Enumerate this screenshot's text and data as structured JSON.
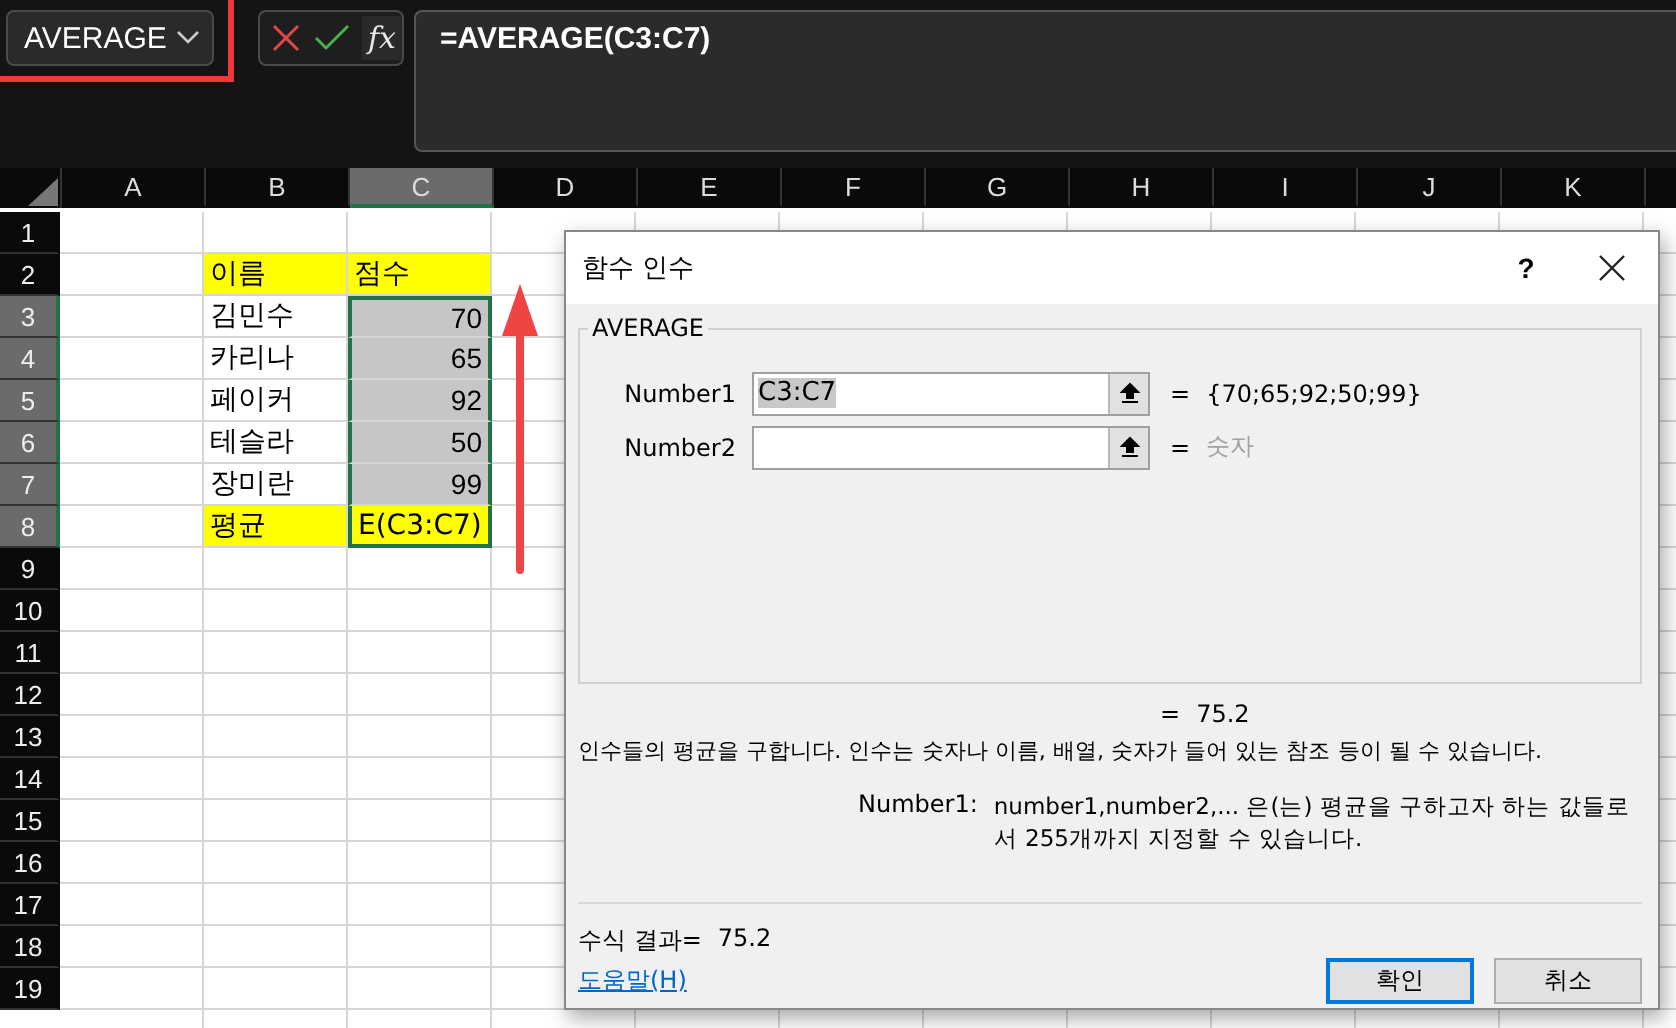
{
  "name_box": {
    "value": "AVERAGE",
    "highlighted": true
  },
  "formula_tools": {
    "function_label": "fx"
  },
  "formula_bar": {
    "value": "=AVERAGE(C3:C7)"
  },
  "sheet": {
    "columns": [
      {
        "label": "A",
        "selected": false
      },
      {
        "label": "B",
        "selected": false
      },
      {
        "label": "C",
        "selected": true
      },
      {
        "label": "D",
        "selected": false
      },
      {
        "label": "E",
        "selected": false
      },
      {
        "label": "F",
        "selected": false
      },
      {
        "label": "G",
        "selected": false
      },
      {
        "label": "H",
        "selected": false
      },
      {
        "label": "I",
        "selected": false
      },
      {
        "label": "J",
        "selected": false
      },
      {
        "label": "K",
        "selected": false
      }
    ],
    "rows": [
      {
        "label": "1",
        "selected": false
      },
      {
        "label": "2",
        "selected": false,
        "column_b": {
          "text": "이름",
          "kind": "text",
          "highlighted": true,
          "selected": false
        },
        "column_c": {
          "text": "점수",
          "kind": "text",
          "highlighted": true,
          "selected": false
        }
      },
      {
        "label": "3",
        "selected": true,
        "column_b": {
          "text": "김민수",
          "kind": "text",
          "highlighted": false,
          "selected": false
        },
        "column_c": {
          "text": "70",
          "kind": "number",
          "highlighted": false,
          "selected": true
        }
      },
      {
        "label": "4",
        "selected": true,
        "column_b": {
          "text": "카리나",
          "kind": "text",
          "highlighted": false,
          "selected": false
        },
        "column_c": {
          "text": "65",
          "kind": "number",
          "highlighted": false,
          "selected": true
        }
      },
      {
        "label": "5",
        "selected": true,
        "column_b": {
          "text": "페이커",
          "kind": "text",
          "highlighted": false,
          "selected": false
        },
        "column_c": {
          "text": "92",
          "kind": "number",
          "highlighted": false,
          "selected": true
        }
      },
      {
        "label": "6",
        "selected": true,
        "column_b": {
          "text": "테슬라",
          "kind": "text",
          "highlighted": false,
          "selected": false
        },
        "column_c": {
          "text": "50",
          "kind": "number",
          "highlighted": false,
          "selected": true
        }
      },
      {
        "label": "7",
        "selected": true,
        "column_b": {
          "text": "장미란",
          "kind": "text",
          "highlighted": false,
          "selected": false
        },
        "column_c": {
          "text": "99",
          "kind": "number",
          "highlighted": false,
          "selected": true
        }
      },
      {
        "label": "8",
        "selected": true,
        "column_b": {
          "text": "평균",
          "kind": "text",
          "highlighted": true,
          "selected": false
        },
        "column_c": {
          "text": "E(C3:C7)",
          "kind": "text",
          "highlighted": true,
          "selected": false
        }
      },
      {
        "label": "9",
        "selected": false
      },
      {
        "label": "10",
        "selected": false
      },
      {
        "label": "11",
        "selected": false
      },
      {
        "label": "12",
        "selected": false
      },
      {
        "label": "13",
        "selected": false
      },
      {
        "label": "14",
        "selected": false
      },
      {
        "label": "15",
        "selected": false
      },
      {
        "label": "16",
        "selected": false
      },
      {
        "label": "17",
        "selected": false
      },
      {
        "label": "18",
        "selected": false
      },
      {
        "label": "19",
        "selected": false
      }
    ]
  },
  "dialog": {
    "title": "함수 인수",
    "help": "?",
    "group": "AVERAGE",
    "arguments": [
      {
        "label": "Number1",
        "value": "C3:C7",
        "value_selected": true,
        "equals": "=",
        "result": "{70;65;92;50;99}",
        "result_dimmed": false
      },
      {
        "label": "Number2",
        "equals": "=",
        "result": "숫자",
        "result_dimmed": true
      }
    ],
    "total": {
      "equals": "=",
      "value": "75.2"
    },
    "description": "인수들의 평균을 구합니다. 인수는 숫자나 이름, 배열, 숫자가 들어 있는 참조 등이 될 수 있습니다.",
    "argument_help": {
      "label": "Number1:",
      "text": "number1,number2,... 은(는) 평균을 구하고자 하는 값들로서 255개까지 지정할 수 있습니다."
    },
    "formula_result": {
      "label": "수식 결과=",
      "value": "75.2"
    },
    "help_link": "도움말(H)",
    "buttons": [
      {
        "label": "확인",
        "default": true
      },
      {
        "label": "취소",
        "default": false
      }
    ]
  }
}
